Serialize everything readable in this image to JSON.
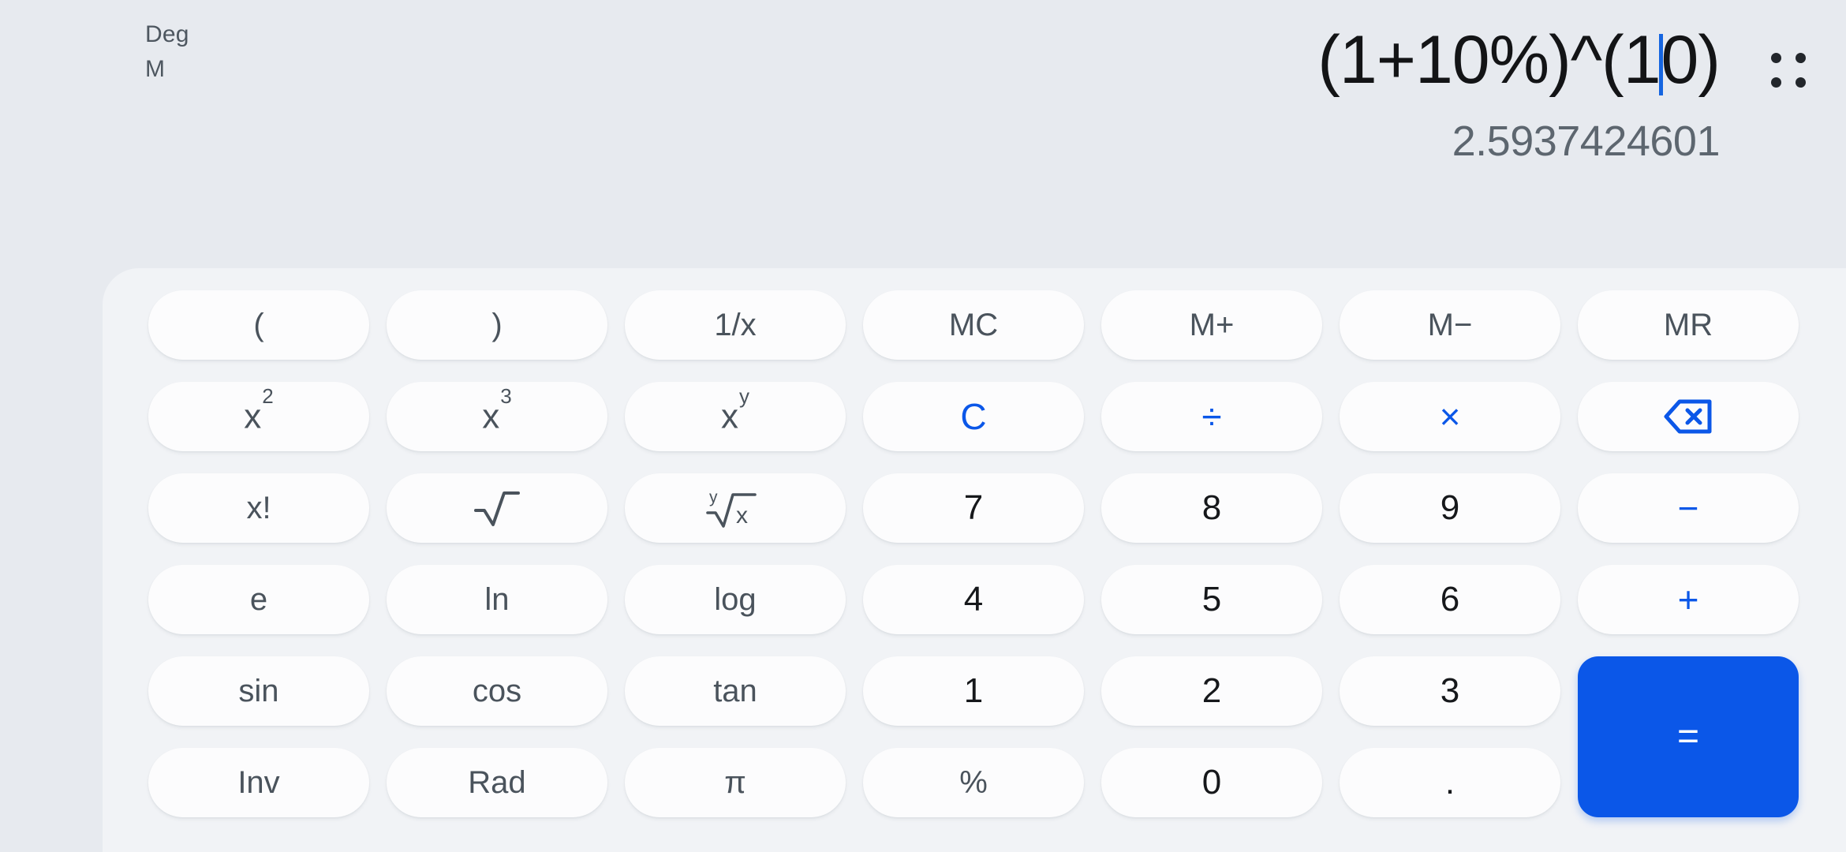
{
  "display": {
    "mode_angle": "Deg",
    "mode_memory": "M",
    "expression_before_caret": "(1+10%)^(1",
    "expression_after_caret": "0)",
    "expression_full": "(1+10%)^(10)",
    "result": "2.5937424601",
    "menu_icon": "grid-dots-icon",
    "caret_color": "#1565e0"
  },
  "colors": {
    "background": "#e7eaef",
    "panel": "#f1f3f6",
    "key": "#fcfcfd",
    "accent": "#0b57e8",
    "label": "#4a535c",
    "number": "#16181b",
    "result": "#5d666f"
  },
  "keys": {
    "row1": [
      {
        "label": "(",
        "name": "key-open-paren",
        "kind": "fn"
      },
      {
        "label": ")",
        "name": "key-close-paren",
        "kind": "fn"
      },
      {
        "label": "1/x",
        "name": "key-reciprocal",
        "kind": "fn"
      },
      {
        "label": "MC",
        "name": "key-memory-clear",
        "kind": "fn"
      },
      {
        "label": "M+",
        "name": "key-memory-add",
        "kind": "fn"
      },
      {
        "label": "M−",
        "name": "key-memory-subtract",
        "kind": "fn"
      },
      {
        "label": "MR",
        "name": "key-memory-recall",
        "kind": "fn"
      }
    ],
    "row2": [
      {
        "label": "x²",
        "name": "key-square",
        "kind": "sup",
        "base": "x",
        "exp": "2"
      },
      {
        "label": "x³",
        "name": "key-cube",
        "kind": "sup",
        "base": "x",
        "exp": "3"
      },
      {
        "label": "xʸ",
        "name": "key-power-y",
        "kind": "sup",
        "base": "x",
        "exp": "y"
      },
      {
        "label": "C",
        "name": "key-clear",
        "kind": "accent"
      },
      {
        "label": "÷",
        "name": "key-divide",
        "kind": "accent"
      },
      {
        "label": "×",
        "name": "key-multiply",
        "kind": "accent"
      },
      {
        "label": "backspace-icon",
        "name": "key-backspace",
        "kind": "icon"
      }
    ],
    "row3": [
      {
        "label": "x!",
        "name": "key-factorial",
        "kind": "fn"
      },
      {
        "label": "√",
        "name": "key-square-root",
        "kind": "icon-sqrt"
      },
      {
        "label": "ʸ√x",
        "name": "key-nth-root",
        "kind": "icon-nthroot"
      },
      {
        "label": "7",
        "name": "key-7",
        "kind": "num"
      },
      {
        "label": "8",
        "name": "key-8",
        "kind": "num"
      },
      {
        "label": "9",
        "name": "key-9",
        "kind": "num"
      },
      {
        "label": "−",
        "name": "key-subtract",
        "kind": "accent"
      }
    ],
    "row4": [
      {
        "label": "e",
        "name": "key-euler",
        "kind": "fn"
      },
      {
        "label": "ln",
        "name": "key-natural-log",
        "kind": "fn"
      },
      {
        "label": "log",
        "name": "key-log",
        "kind": "fn"
      },
      {
        "label": "4",
        "name": "key-4",
        "kind": "num"
      },
      {
        "label": "5",
        "name": "key-5",
        "kind": "num"
      },
      {
        "label": "6",
        "name": "key-6",
        "kind": "num"
      },
      {
        "label": "+",
        "name": "key-add",
        "kind": "accent"
      }
    ],
    "row5": [
      {
        "label": "sin",
        "name": "key-sin",
        "kind": "fn"
      },
      {
        "label": "cos",
        "name": "key-cos",
        "kind": "fn"
      },
      {
        "label": "tan",
        "name": "key-tan",
        "kind": "fn"
      },
      {
        "label": "1",
        "name": "key-1",
        "kind": "num"
      },
      {
        "label": "2",
        "name": "key-2",
        "kind": "num"
      },
      {
        "label": "3",
        "name": "key-3",
        "kind": "num"
      }
    ],
    "row6": [
      {
        "label": "Inv",
        "name": "key-inverse",
        "kind": "fn"
      },
      {
        "label": "Rad",
        "name": "key-radian",
        "kind": "fn"
      },
      {
        "label": "π",
        "name": "key-pi",
        "kind": "fn"
      },
      {
        "label": "%",
        "name": "key-percent",
        "kind": "fn"
      },
      {
        "label": "0",
        "name": "key-0",
        "kind": "num"
      },
      {
        "label": ".",
        "name": "key-decimal",
        "kind": "num"
      }
    ],
    "equals": {
      "label": "=",
      "name": "key-equals"
    }
  }
}
